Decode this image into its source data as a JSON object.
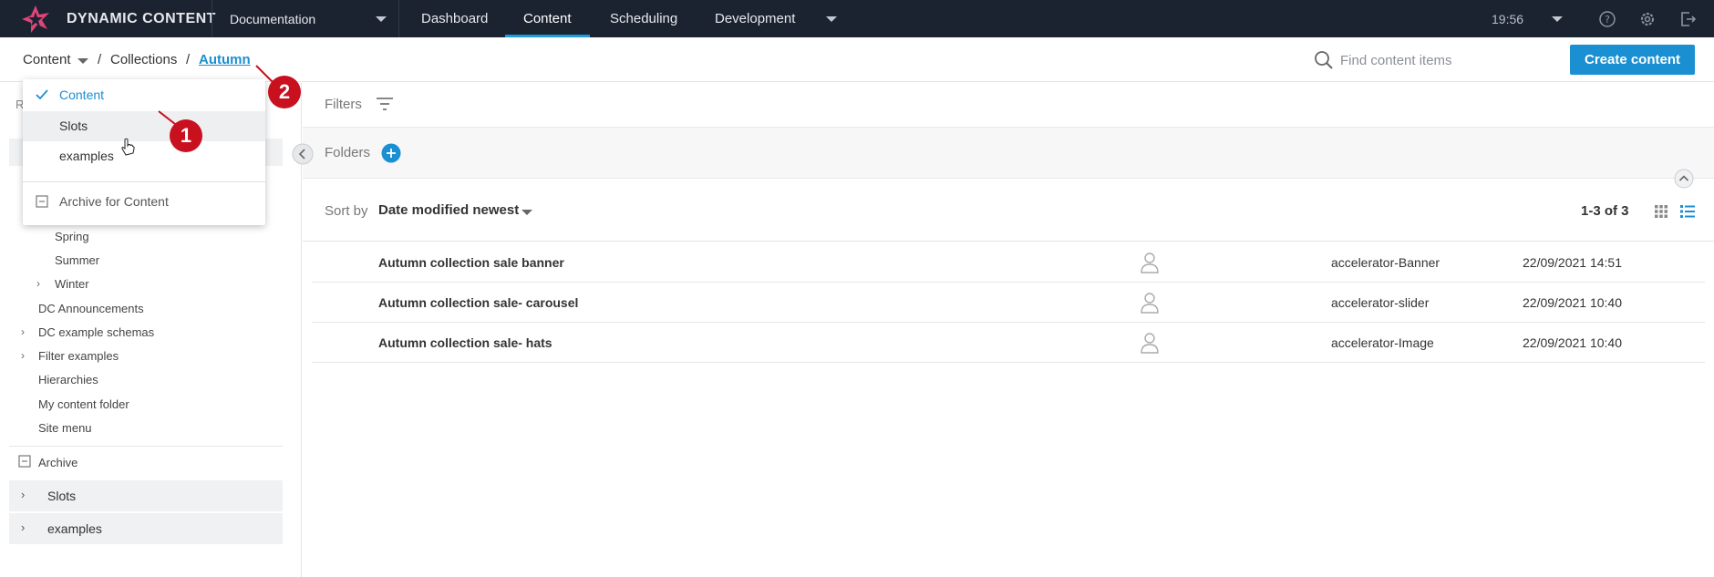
{
  "app": {
    "brand": "DYNAMIC CONTENT",
    "hub_name": "Documentation",
    "nav_tabs": [
      {
        "label": "Dashboard",
        "active": false
      },
      {
        "label": "Content",
        "active": true
      },
      {
        "label": "Scheduling",
        "active": false
      },
      {
        "label": "Development",
        "active": false
      }
    ],
    "clock": "19:56",
    "icons": [
      "help-icon",
      "settings-icon",
      "logout-icon"
    ],
    "accent_color": "#1a8fd1",
    "topbar_color": "#1b2330"
  },
  "breadcrumb": {
    "root": "Content",
    "sep1": "/",
    "middle": "Collections",
    "sep2": "/",
    "current": "Autumn"
  },
  "search": {
    "placeholder": "Find content items"
  },
  "create_button": "Create content",
  "repo_dropdown": {
    "items": [
      {
        "label": "Content",
        "checked": true
      },
      {
        "label": "Slots",
        "hovered": true
      },
      {
        "label": "examples"
      }
    ],
    "archive_label": "Archive for Content"
  },
  "sidebar": {
    "clipped_label": "R",
    "tree": [
      {
        "label": "Spring",
        "expandable": false
      },
      {
        "label": "Summer",
        "expandable": false
      },
      {
        "label": "Winter",
        "expandable": true
      },
      {
        "label": "DC Announcements",
        "expandable": false
      },
      {
        "label": "DC example schemas",
        "expandable": true
      },
      {
        "label": "Filter examples",
        "expandable": true
      },
      {
        "label": "Hierarchies",
        "expandable": false
      },
      {
        "label": "My content folder",
        "expandable": false
      },
      {
        "label": "Site menu",
        "expandable": false
      }
    ],
    "archive_label": "Archive",
    "repositories": [
      "Slots",
      "examples"
    ]
  },
  "filters": {
    "label": "Filters"
  },
  "folders": {
    "label": "Folders"
  },
  "sort": {
    "label": "Sort by",
    "value": "Date modified newest",
    "count": "1-3 of 3"
  },
  "items": [
    {
      "name": "Autumn collection sale banner",
      "type": "accelerator-Banner",
      "date": "22/09/2021 14:51"
    },
    {
      "name": "Autumn collection sale- carousel",
      "type": "accelerator-slider",
      "date": "22/09/2021 10:40"
    },
    {
      "name": "Autumn collection sale- hats",
      "type": "accelerator-Image",
      "date": "22/09/2021 10:40"
    }
  ],
  "annotations": [
    "1",
    "2"
  ]
}
